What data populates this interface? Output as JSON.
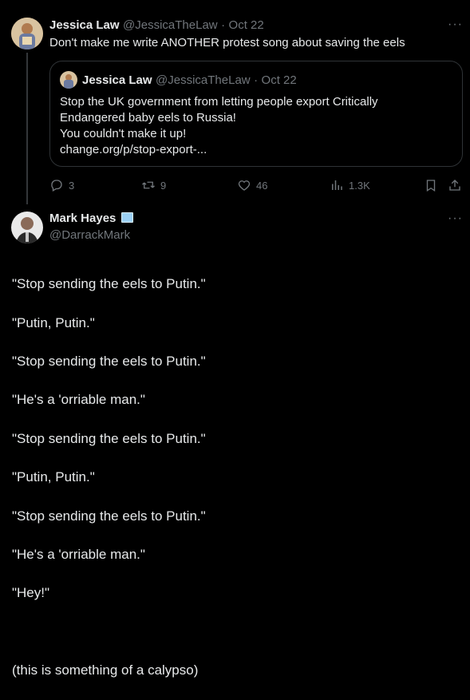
{
  "tweet": {
    "author_name": "Jessica Law",
    "handle": "@JessicaTheLaw",
    "sep": "·",
    "date": "Oct 22",
    "text": "Don't make me write ANOTHER protest song about saving the eels",
    "quote": {
      "author_name": "Jessica Law",
      "handle": "@JessicaTheLaw",
      "sep": "·",
      "date": "Oct 22",
      "text_lines": [
        "Stop the UK government from letting people export Critically",
        "Endangered baby eels to Russia!",
        "You couldn't make it up!",
        "change.org/p/stop-export-..."
      ]
    },
    "actions": {
      "replies": "3",
      "retweets": "9",
      "likes": "46",
      "views": "1.3K"
    }
  },
  "reply": {
    "author_name": "Mark Hayes",
    "badge_icon": "book-emoji-icon",
    "handle": "@DarrackMark",
    "lines": [
      "\"Stop sending the eels to Putin.\"",
      "\"Putin, Putin.\"",
      "\"Stop sending the eels to Putin.\"",
      "\"He's a 'orriable man.\"",
      "\"Stop sending the eels to Putin.\"",
      "\"Putin, Putin.\"",
      "\"Stop sending the eels to Putin.\"",
      "\"He's a 'orriable man.\"",
      "\"Hey!\"",
      "",
      "(this is something of a calypso)"
    ]
  },
  "icons": {
    "more": "more-options-icon",
    "reply": "reply-icon",
    "retweet": "retweet-icon",
    "like": "like-icon",
    "views": "views-icon",
    "bookmark": "bookmark-icon",
    "share": "share-icon"
  },
  "colors": {
    "background": "#000000",
    "text": "#e7e9ea",
    "muted": "#71767b",
    "border": "#2f3336"
  }
}
